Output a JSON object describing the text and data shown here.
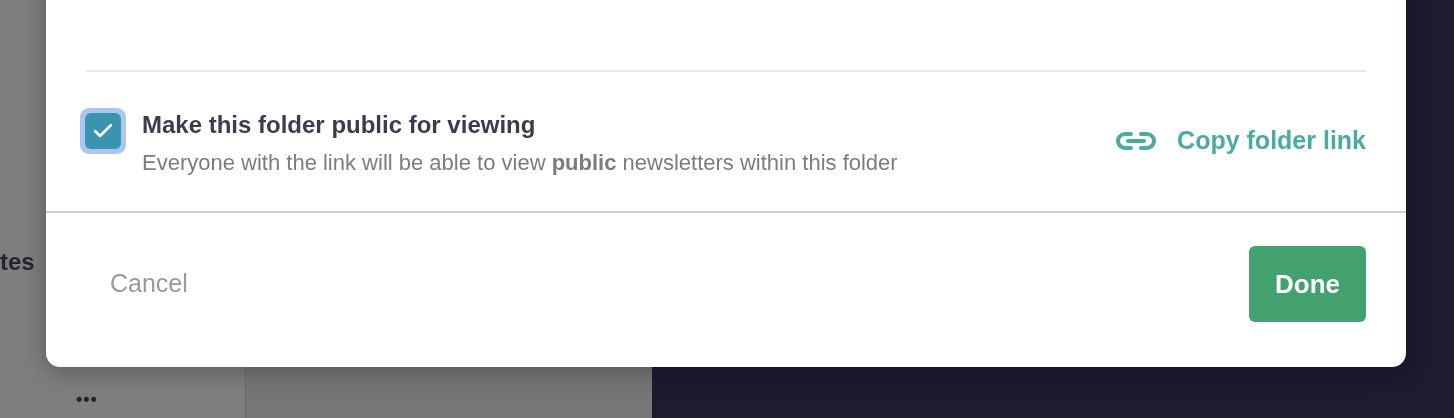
{
  "background": {
    "sidebar_text": "tes",
    "more_text": "•••"
  },
  "dialog": {
    "public_option": {
      "checked": true,
      "title": "Make this folder public for viewing",
      "description": "Everyone with the link will be able to view **public** newsletters within this folder"
    },
    "copy_link": "Copy folder link",
    "buttons": [
      {
        "kind": "cancel",
        "label": "Cancel"
      },
      {
        "kind": "primary",
        "label": "Done"
      }
    ]
  }
}
